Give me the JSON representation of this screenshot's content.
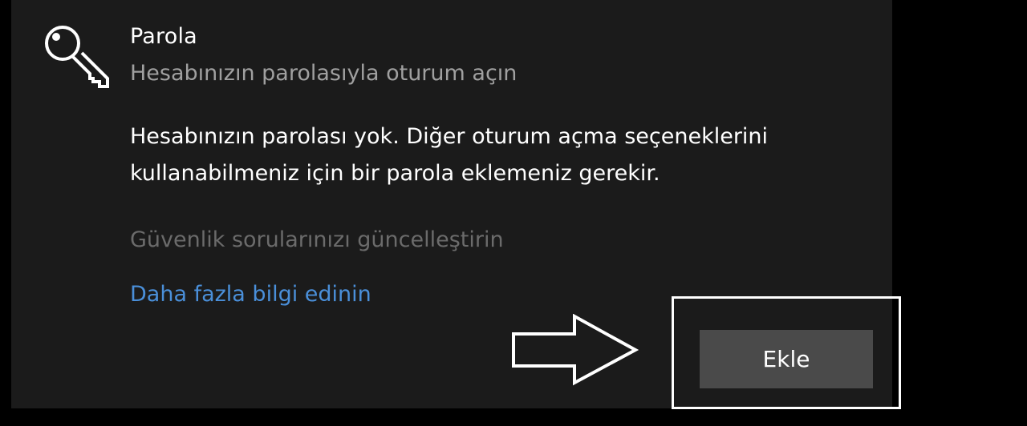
{
  "option": {
    "icon": "key-icon",
    "title": "Parola",
    "subtitle": "Hesabınızın parolasıyla oturum açın"
  },
  "description": {
    "line1": "Hesabınızın parolası yok. Diğer oturum açma seçeneklerini",
    "line2": "kullanabilmeniz için bir parola eklemeniz gerekir."
  },
  "links": {
    "security_questions": "Güvenlik sorularınızı güncelleştirin",
    "learn_more": "Daha fazla bilgi edinin"
  },
  "actions": {
    "add_label": "Ekle"
  },
  "annotation": {
    "arrow_icon": "right-arrow-outline-icon",
    "highlight": "highlight-box"
  },
  "colors": {
    "background": "#000000",
    "panel": "#1b1b1b",
    "title": "#ffffff",
    "subtitle": "#a0a0a0",
    "disabled_link": "#6b6b6b",
    "link": "#4a8fd9",
    "button": "#4a4a4a"
  }
}
